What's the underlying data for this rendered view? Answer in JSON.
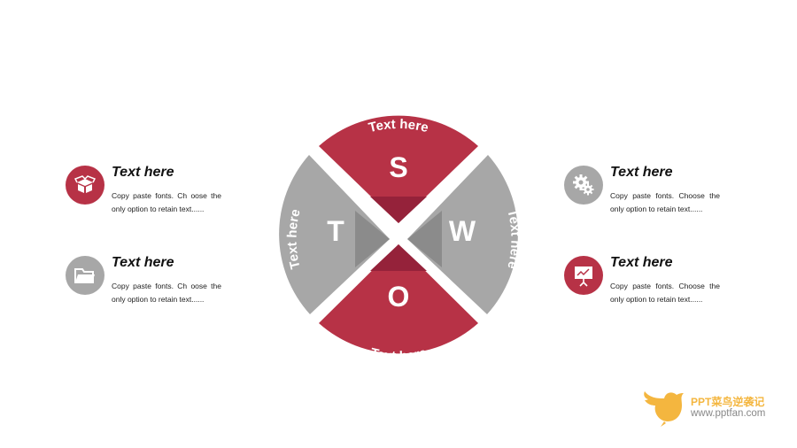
{
  "swot": {
    "segments": [
      {
        "letter": "S",
        "label": "Text here",
        "color": "#b73246"
      },
      {
        "letter": "W",
        "label": "Text here",
        "color": "#a7a7a7"
      },
      {
        "letter": "O",
        "label": "Text here",
        "color": "#b73246"
      },
      {
        "letter": "T",
        "label": "Text here",
        "color": "#a7a7a7"
      }
    ]
  },
  "items": [
    {
      "title": "Text here",
      "desc": "Copy paste fonts. Ch oose the only option to retain text......",
      "icon": "box-icon",
      "color": "#b73246"
    },
    {
      "title": "Text here",
      "desc": "Copy paste fonts. Ch oose the only option to retain text......",
      "icon": "folder-icon",
      "color": "#a7a7a7"
    },
    {
      "title": "Text here",
      "desc": "Copy paste fonts. Choose the only option to retain text......",
      "icon": "gears-icon",
      "color": "#a7a7a7"
    },
    {
      "title": "Text here",
      "desc": "Copy paste fonts. Choose the only option to retain text......",
      "icon": "presentation-icon",
      "color": "#b73246"
    }
  ],
  "logo": {
    "line1": "PPT菜鸟逆袭记",
    "line2": "www.pptfan.com",
    "color": "#f4b63f"
  }
}
